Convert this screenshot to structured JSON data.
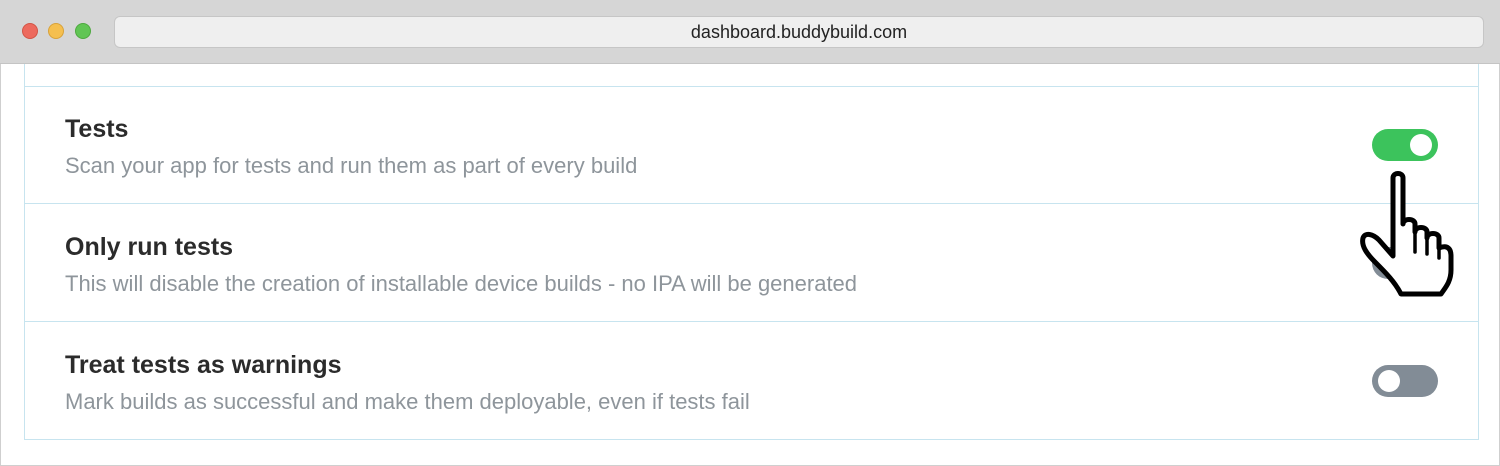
{
  "browser": {
    "url": "dashboard.buddybuild.com"
  },
  "settings": [
    {
      "title": "Tests",
      "description": "Scan your app for tests and run them as part of every build",
      "enabled": true
    },
    {
      "title": "Only run tests",
      "description": "This will disable the creation of installable device builds - no IPA will be generated",
      "enabled": false
    },
    {
      "title": "Treat tests as warnings",
      "description": "Mark builds as successful and make them deployable, even if tests fail",
      "enabled": false
    }
  ],
  "colors": {
    "toggle_on": "#3cc35c",
    "toggle_off": "#828c96",
    "row_border": "#c7e4ef"
  },
  "icons": {
    "cursor": "pointing-hand-cursor-icon"
  }
}
